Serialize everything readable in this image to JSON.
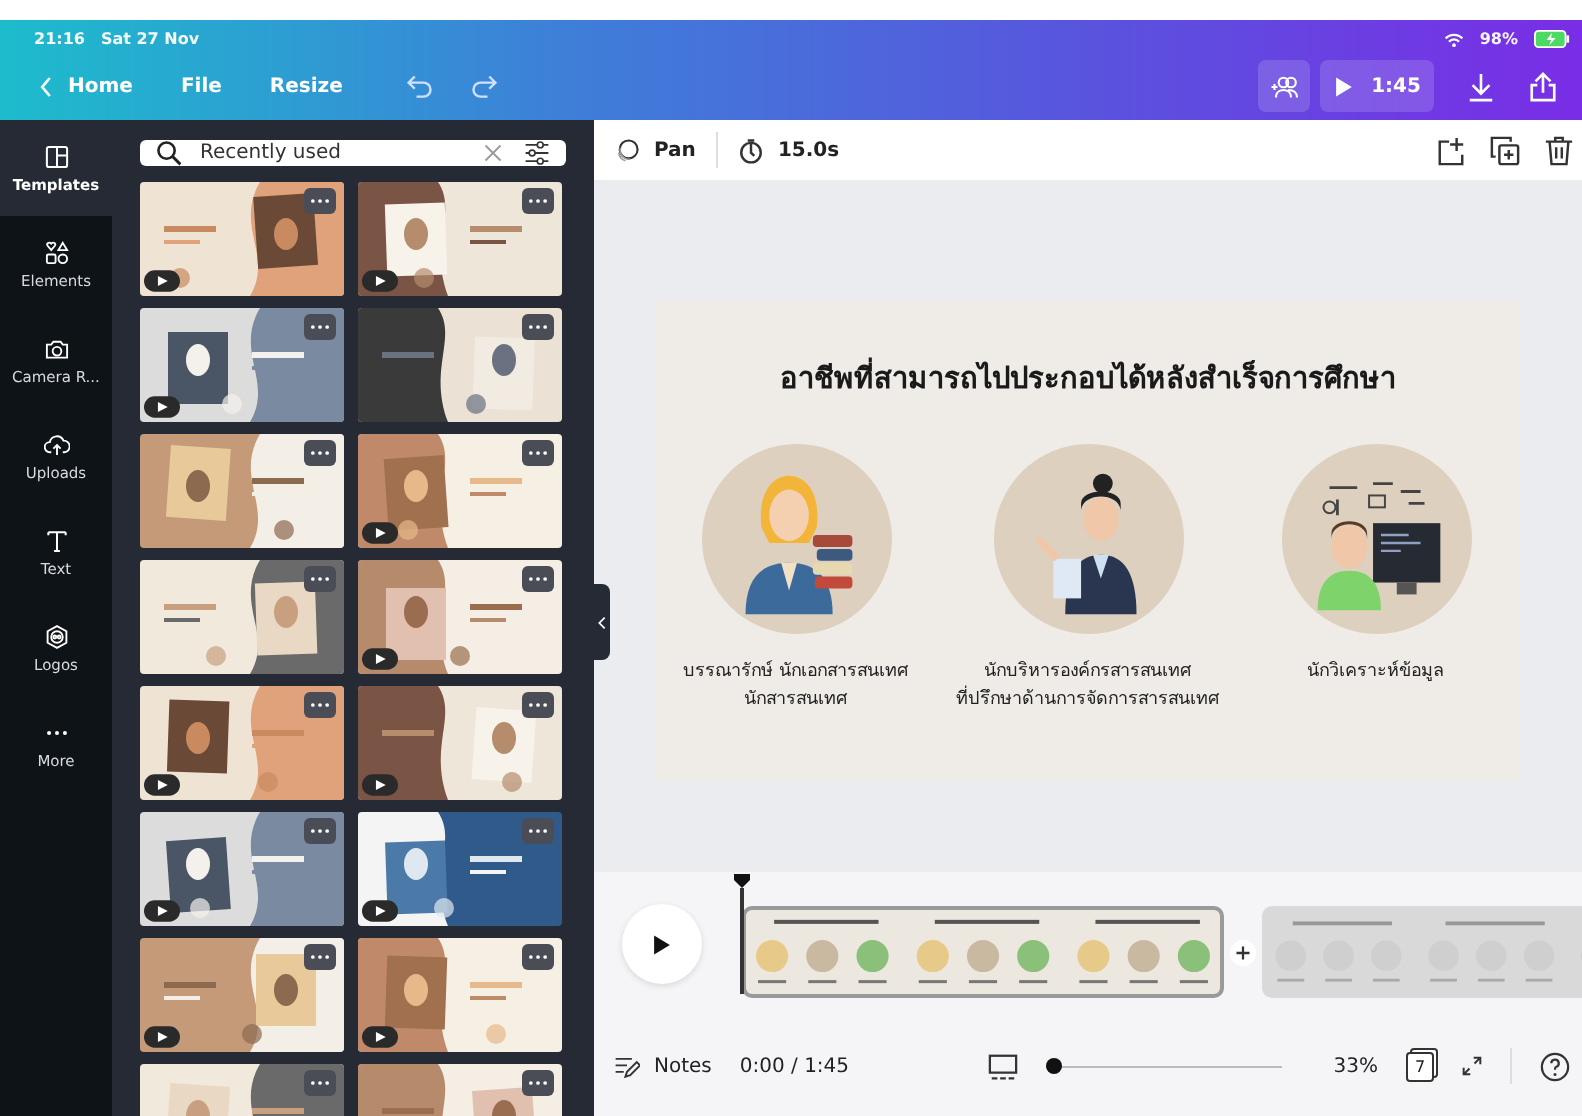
{
  "status_bar": {
    "time": "21:16",
    "date": "Sat 27 Nov",
    "battery": "98%"
  },
  "top_bar": {
    "back": "Home",
    "menu": [
      "File",
      "Resize"
    ],
    "play_duration": "1:45"
  },
  "side_rail": [
    {
      "label": "Templates",
      "kind": "templates",
      "selected": true
    },
    {
      "label": "Elements",
      "kind": "elements",
      "selected": false
    },
    {
      "label": "Camera R...",
      "kind": "camera",
      "selected": false
    },
    {
      "label": "Uploads",
      "kind": "uploads",
      "selected": false
    },
    {
      "label": "Text",
      "kind": "text",
      "selected": false
    },
    {
      "label": "Logos",
      "kind": "logos",
      "selected": false
    },
    {
      "label": "More",
      "kind": "more",
      "selected": false
    }
  ],
  "search": {
    "value": "Recently used"
  },
  "templates": [
    {
      "video": true
    },
    {
      "video": true
    },
    {
      "video": true
    },
    {
      "video": false
    },
    {
      "video": false
    },
    {
      "video": true
    },
    {
      "video": false
    },
    {
      "video": true
    },
    {
      "video": true
    },
    {
      "video": true
    },
    {
      "video": true
    },
    {
      "video": true
    },
    {
      "video": true
    },
    {
      "video": true
    },
    {
      "video": false
    },
    {
      "video": false
    }
  ],
  "toolbar": {
    "animation": "Pan",
    "duration": "15.0s"
  },
  "slide": {
    "title": "อาชีพที่สามารถไปประกอบได้หลังสำเร็จการศึกษา",
    "careers": [
      {
        "kind": "books",
        "label": "บรรณารักษ์ นักเอกสารสนเทศ\nนักสารสนเทศ"
      },
      {
        "kind": "papers",
        "label": "นักบริหารองค์กรสารสนเทศ\nที่ปรึกษาด้านการจัดการสารสนเทศ"
      },
      {
        "kind": "computer",
        "label": "นักวิเคราะห์ข้อมูล"
      }
    ]
  },
  "timeline": {
    "clips": [
      {
        "selected": true
      },
      {
        "selected": false
      }
    ]
  },
  "bottom_bar": {
    "notes": "Notes",
    "time": "0:00 / 1:45",
    "zoom": "33%",
    "zoom_level": {
      "level": 0.04
    },
    "pages": "7"
  }
}
